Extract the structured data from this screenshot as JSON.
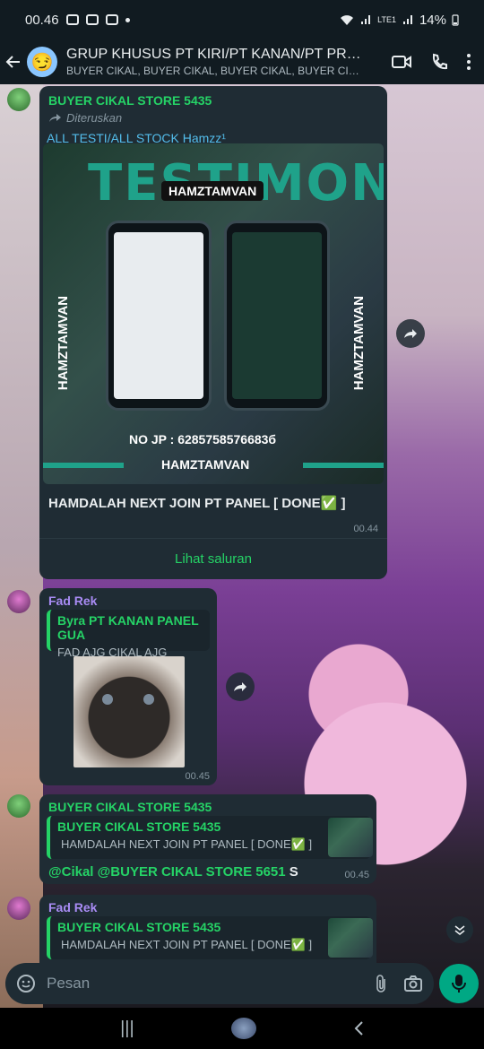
{
  "status_bar": {
    "time": "00.46",
    "network": "LTE1",
    "battery": "14%"
  },
  "header": {
    "group_name": "GRUP KHUSUS  PT KIRI/PT KANAN/PT PRI...",
    "members": "BUYER CIKAL, BUYER CIKAL, BUYER CIKAL, BUYER CIKAL,...",
    "avatar_emoji": "😏"
  },
  "messages": [
    {
      "sender": "BUYER CIKAL STORE 5435",
      "sender_color": "#25d366",
      "forwarded_label": "Diteruskan",
      "link_title": "ALL TESTI/ALL STOCK Hamzz¹",
      "image": {
        "headline": "TESTIMONI",
        "brand": "HAMZTAMVAN",
        "side_text": "HAMZTAMVAN",
        "phone_number": "NO JP : 6285758576683б"
      },
      "text": "HAMDALAH NEXT JOIN PT PANEL [ DONE✅ ]",
      "time": "00.44",
      "channel_button": "Lihat saluran"
    },
    {
      "sender": "Fad Rek",
      "sender_color": "#a98cf5",
      "reply_to": {
        "sender": "Byra PT KANAN PANEL GUA",
        "text": "FAD AJG CIKAL AJG"
      },
      "time": "00.45"
    },
    {
      "sender": "BUYER CIKAL STORE 5435",
      "sender_color": "#25d366",
      "reply_to": {
        "sender": "BUYER CIKAL STORE 5435",
        "text": "HAMDALAH NEXT JOIN PT PANEL [ DONE✅ ]"
      },
      "text_mentions": "@Cikal @BUYER CIKAL STORE 5651",
      "text_tail": " S",
      "time": "00.45"
    },
    {
      "sender": "Fad Rek",
      "sender_color": "#a98cf5",
      "reply_to": {
        "sender": "BUYER CIKAL STORE 5435",
        "text": "HAMDALAH NEXT JOIN PT PANEL [ DONE✅ ]"
      }
    }
  ],
  "composer": {
    "placeholder": "Pesan"
  },
  "colors": {
    "accent": "#25d366",
    "bubble": "#1f2c34",
    "mic": "#00a884",
    "link": "#53bdeb"
  },
  "icons": [
    "back-arrow-icon",
    "video-call-icon",
    "phone-icon",
    "more-vert-icon",
    "forward-icon",
    "sticker-icon",
    "attach-icon",
    "camera-icon",
    "mic-icon",
    "chevron-down-icon"
  ]
}
